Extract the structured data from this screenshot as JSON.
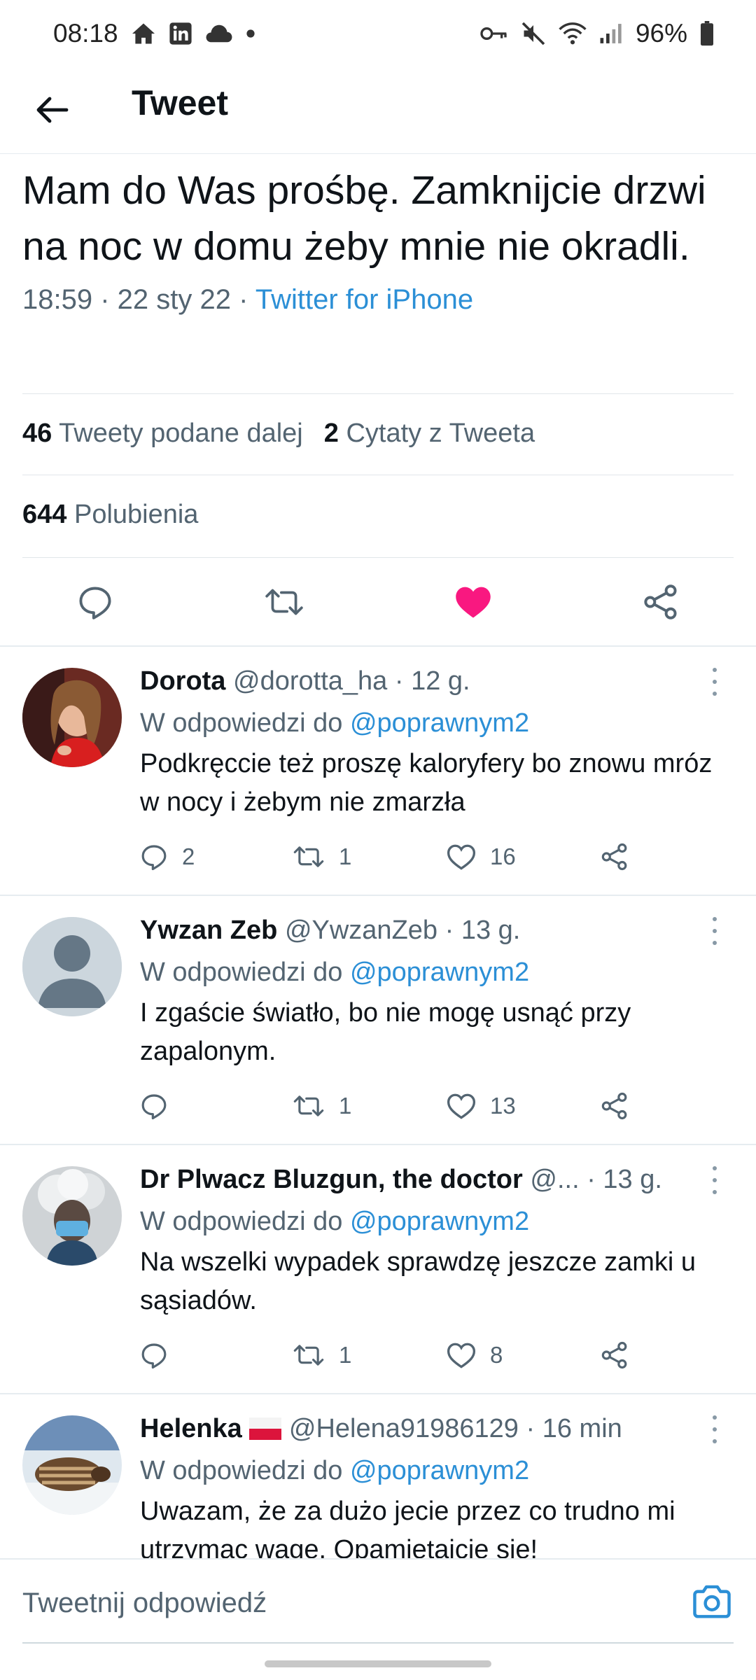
{
  "status_bar": {
    "time": "08:18",
    "battery": "96%",
    "icons_left": [
      "home-icon",
      "linkedin-icon",
      "cloud-icon",
      "dot-icon"
    ],
    "icons_right": [
      "key-icon",
      "mute-icon",
      "wifi-icon",
      "signal-icon",
      "battery-icon"
    ]
  },
  "header": {
    "title": "Tweet"
  },
  "main_tweet": {
    "text": "Mam do Was prośbę. Zamknijcie drzwi na noc w domu żeby mnie nie okradli.",
    "time": "18:59",
    "date": "22 sty 22",
    "source": "Twitter for iPhone",
    "retweets_count": "46",
    "retweets_label": "Tweety podane dalej",
    "quotes_count": "2",
    "quotes_label": "Cytaty z Tweeta",
    "likes_count": "644",
    "likes_label": "Polubienia",
    "liked": true,
    "like_color": "#f91880"
  },
  "reply_prefix": "W odpowiedzi do",
  "replies": [
    {
      "name": "Dorota",
      "handle": "@dorotta_ha",
      "time": "· 12 g.",
      "reply_to": "@poprawnym2",
      "text": "Podkręccie też proszę kaloryfery bo znowu mróz w nocy i żebym nie zmarzła",
      "replies": "2",
      "retweets": "1",
      "likes": "16"
    },
    {
      "name": "Ywzan Zeb",
      "handle": "@YwzanZeb",
      "time": "· 13 g.",
      "reply_to": "@poprawnym2",
      "text": "I zgaście światło, bo nie mogę usnąć przy zapalonym.",
      "replies": "",
      "retweets": "1",
      "likes": "13"
    },
    {
      "name": "Dr Plwacz Bluzgun, the doctor",
      "handle": "@...",
      "time": "· 13 g.",
      "reply_to": "@poprawnym2",
      "text": "Na wszelki wypadek sprawdzę jeszcze zamki u sąsiadów.",
      "replies": "",
      "retweets": "1",
      "likes": "8"
    },
    {
      "name": "Helenka",
      "handle": "@Helena91986129",
      "time": "· 16 min",
      "reply_to": "@poprawnym2",
      "text": "Uwazam, że za dużo jecie przez co trudno mi utrzymac wage. Opamietajcie sie!",
      "replies": "",
      "retweets": "",
      "likes": ""
    }
  ],
  "compose": {
    "placeholder": "Tweetnij odpowiedź"
  },
  "colors": {
    "accent": "#2b8fd6",
    "secondary_text": "#536471",
    "like": "#f91880"
  }
}
